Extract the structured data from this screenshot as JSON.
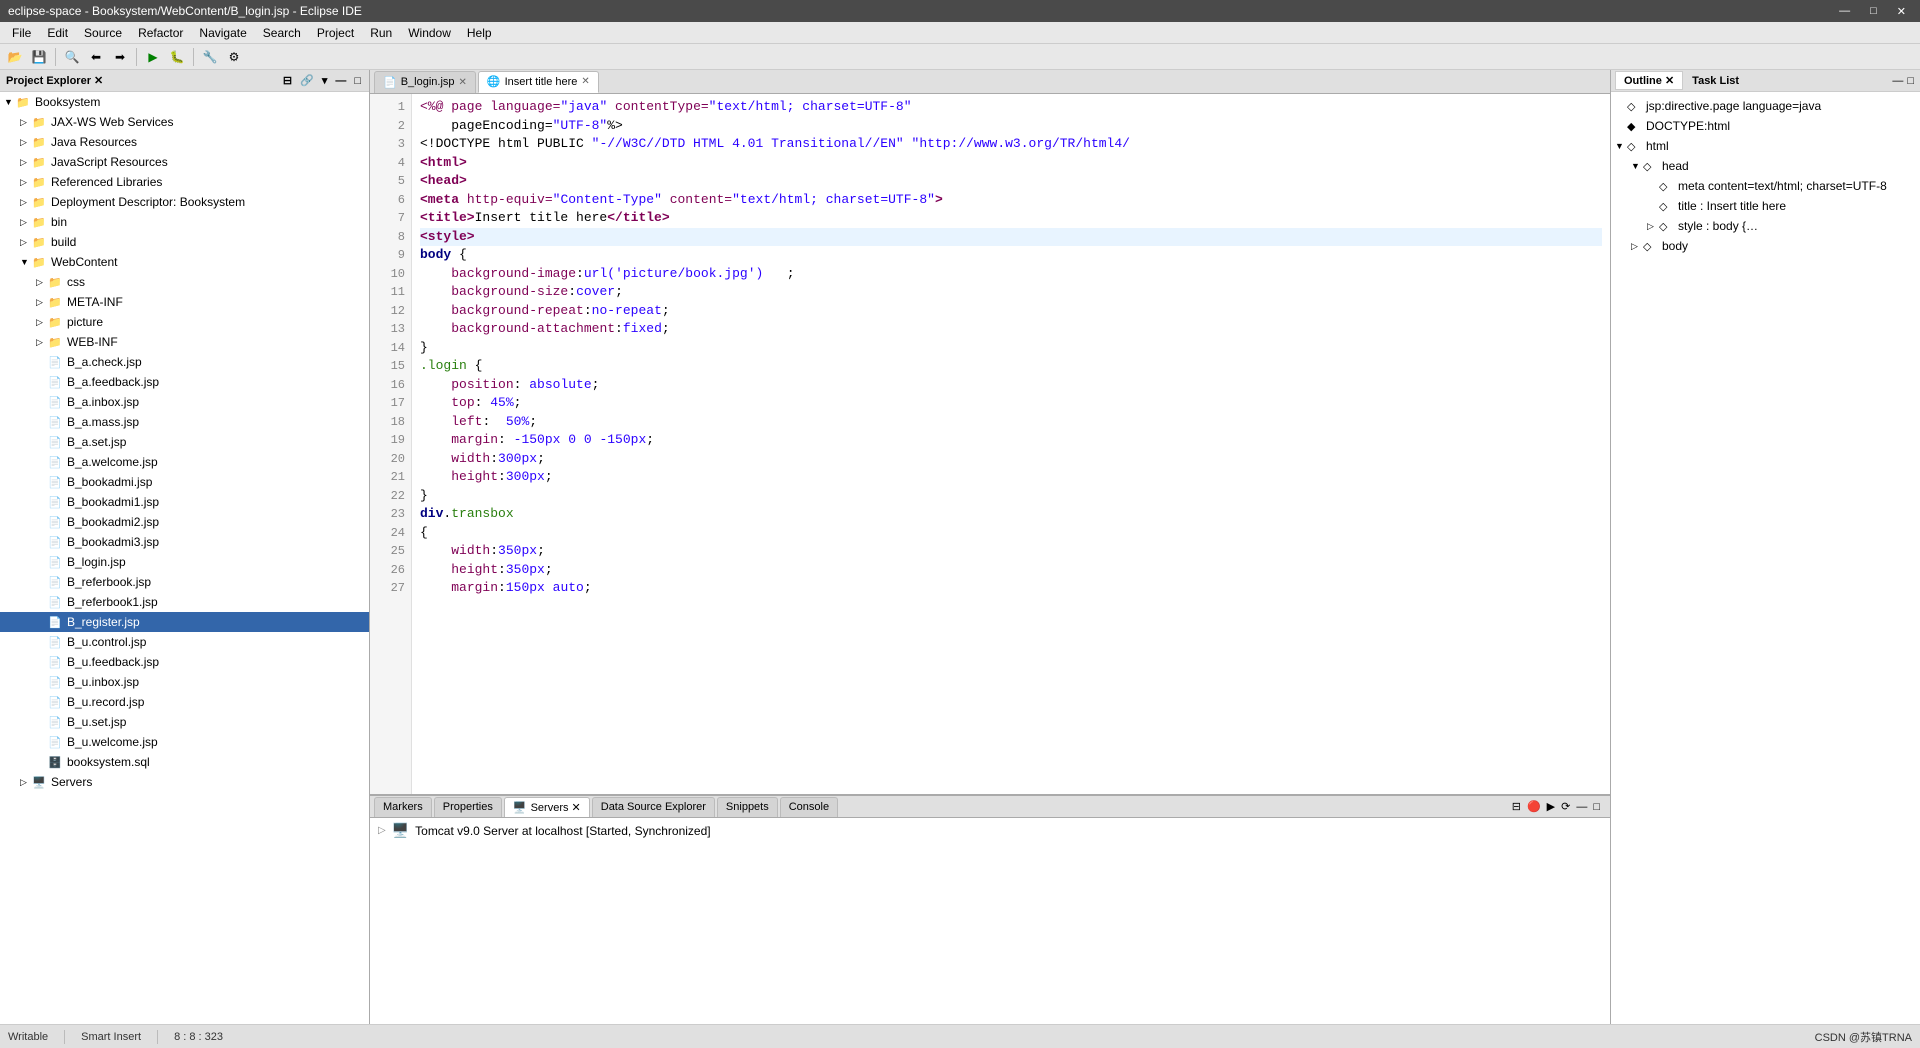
{
  "titlebar": {
    "title": "eclipse-space - Booksystem/WebContent/B_login.jsp - Eclipse IDE",
    "min_label": "—",
    "max_label": "□",
    "close_label": "✕"
  },
  "menubar": {
    "items": [
      "File",
      "Edit",
      "Source",
      "Refactor",
      "Navigate",
      "Search",
      "Project",
      "Run",
      "Window",
      "Help"
    ]
  },
  "left_panel": {
    "title": "Project Explorer ✕",
    "tree": [
      {
        "indent": 0,
        "arrow": "▼",
        "icon": "📁",
        "label": "Booksystem",
        "type": "project"
      },
      {
        "indent": 1,
        "arrow": "▷",
        "icon": "📁",
        "label": "JAX-WS Web Services",
        "type": "folder"
      },
      {
        "indent": 1,
        "arrow": "▷",
        "icon": "📁",
        "label": "Java Resources",
        "type": "folder"
      },
      {
        "indent": 1,
        "arrow": "▷",
        "icon": "📁",
        "label": "JavaScript Resources",
        "type": "folder"
      },
      {
        "indent": 1,
        "arrow": "▷",
        "icon": "📁",
        "label": "Referenced Libraries",
        "type": "folder"
      },
      {
        "indent": 1,
        "arrow": "▷",
        "icon": "📁",
        "label": "Deployment Descriptor: Booksystem",
        "type": "folder"
      },
      {
        "indent": 1,
        "arrow": "▷",
        "icon": "📁",
        "label": "bin",
        "type": "folder"
      },
      {
        "indent": 1,
        "arrow": "▷",
        "icon": "📁",
        "label": "build",
        "type": "folder"
      },
      {
        "indent": 1,
        "arrow": "▼",
        "icon": "📁",
        "label": "WebContent",
        "type": "folder"
      },
      {
        "indent": 2,
        "arrow": "▷",
        "icon": "📁",
        "label": "css",
        "type": "folder"
      },
      {
        "indent": 2,
        "arrow": "▷",
        "icon": "📁",
        "label": "META-INF",
        "type": "folder"
      },
      {
        "indent": 2,
        "arrow": "▷",
        "icon": "📁",
        "label": "picture",
        "type": "folder"
      },
      {
        "indent": 2,
        "arrow": "▷",
        "icon": "📁",
        "label": "WEB-INF",
        "type": "folder"
      },
      {
        "indent": 2,
        "arrow": "",
        "icon": "📄",
        "label": "B_a.check.jsp",
        "type": "file"
      },
      {
        "indent": 2,
        "arrow": "",
        "icon": "📄",
        "label": "B_a.feedback.jsp",
        "type": "file"
      },
      {
        "indent": 2,
        "arrow": "",
        "icon": "📄",
        "label": "B_a.inbox.jsp",
        "type": "file"
      },
      {
        "indent": 2,
        "arrow": "",
        "icon": "📄",
        "label": "B_a.mass.jsp",
        "type": "file"
      },
      {
        "indent": 2,
        "arrow": "",
        "icon": "📄",
        "label": "B_a.set.jsp",
        "type": "file"
      },
      {
        "indent": 2,
        "arrow": "",
        "icon": "📄",
        "label": "B_a.welcome.jsp",
        "type": "file"
      },
      {
        "indent": 2,
        "arrow": "",
        "icon": "📄",
        "label": "B_bookadmi.jsp",
        "type": "file"
      },
      {
        "indent": 2,
        "arrow": "",
        "icon": "📄",
        "label": "B_bookadmi1.jsp",
        "type": "file"
      },
      {
        "indent": 2,
        "arrow": "",
        "icon": "📄",
        "label": "B_bookadmi2.jsp",
        "type": "file"
      },
      {
        "indent": 2,
        "arrow": "",
        "icon": "📄",
        "label": "B_bookadmi3.jsp",
        "type": "file"
      },
      {
        "indent": 2,
        "arrow": "",
        "icon": "📄",
        "label": "B_login.jsp",
        "type": "file"
      },
      {
        "indent": 2,
        "arrow": "",
        "icon": "📄",
        "label": "B_referbook.jsp",
        "type": "file"
      },
      {
        "indent": 2,
        "arrow": "",
        "icon": "📄",
        "label": "B_referbook1.jsp",
        "type": "file"
      },
      {
        "indent": 2,
        "arrow": "",
        "icon": "📄",
        "label": "B_register.jsp",
        "type": "file",
        "selected": true
      },
      {
        "indent": 2,
        "arrow": "",
        "icon": "📄",
        "label": "B_u.control.jsp",
        "type": "file"
      },
      {
        "indent": 2,
        "arrow": "",
        "icon": "📄",
        "label": "B_u.feedback.jsp",
        "type": "file"
      },
      {
        "indent": 2,
        "arrow": "",
        "icon": "📄",
        "label": "B_u.inbox.jsp",
        "type": "file"
      },
      {
        "indent": 2,
        "arrow": "",
        "icon": "📄",
        "label": "B_u.record.jsp",
        "type": "file"
      },
      {
        "indent": 2,
        "arrow": "",
        "icon": "📄",
        "label": "B_u.set.jsp",
        "type": "file"
      },
      {
        "indent": 2,
        "arrow": "",
        "icon": "📄",
        "label": "B_u.welcome.jsp",
        "type": "file"
      },
      {
        "indent": 2,
        "arrow": "",
        "icon": "🗄️",
        "label": "booksystem.sql",
        "type": "file"
      },
      {
        "indent": 1,
        "arrow": "▷",
        "icon": "🖥️",
        "label": "Servers",
        "type": "folder"
      }
    ]
  },
  "editor": {
    "tabs": [
      {
        "label": "B_login.jsp",
        "icon": "📄",
        "active": false
      },
      {
        "label": "Insert title here",
        "icon": "🌐",
        "active": true
      }
    ],
    "active_line": 8,
    "lines": [
      {
        "num": 1,
        "code": "<%@ page language=\"java\" contentType=\"text/html; charset=UTF-8\""
      },
      {
        "num": 2,
        "code": "    pageEncoding=\"UTF-8\"%>"
      },
      {
        "num": 3,
        "code": "<!DOCTYPE html PUBLIC \"-//W3C//DTD HTML 4.01 Transitional//EN\" \"http://www.w3.org/TR/html4/"
      },
      {
        "num": 4,
        "code": "<html>"
      },
      {
        "num": 5,
        "code": "<head>"
      },
      {
        "num": 6,
        "code": "<meta http-equiv=\"Content-Type\" content=\"text/html; charset=UTF-8\">"
      },
      {
        "num": 7,
        "code": "<title>Insert title here</title>"
      },
      {
        "num": 8,
        "code": "<style>"
      },
      {
        "num": 9,
        "code": "body {"
      },
      {
        "num": 10,
        "code": "    background-image:url('picture/book.jpg')   ;"
      },
      {
        "num": 11,
        "code": "    background-size:cover;"
      },
      {
        "num": 12,
        "code": "    background-repeat:no-repeat;"
      },
      {
        "num": 13,
        "code": "    background-attachment:fixed;"
      },
      {
        "num": 14,
        "code": "}"
      },
      {
        "num": 15,
        "code": ".login {"
      },
      {
        "num": 16,
        "code": "    position: absolute;"
      },
      {
        "num": 17,
        "code": "    top: 45%;"
      },
      {
        "num": 18,
        "code": "    left: 50%;"
      },
      {
        "num": 19,
        "code": "    margin: -150px 0 0 -150px;"
      },
      {
        "num": 20,
        "code": "    width:300px;"
      },
      {
        "num": 21,
        "code": "    height:300px;"
      },
      {
        "num": 22,
        "code": "}"
      },
      {
        "num": 23,
        "code": "div.transbox"
      },
      {
        "num": 24,
        "code": "{"
      },
      {
        "num": 25,
        "code": "    width:350px;"
      },
      {
        "num": 26,
        "code": "    height:350px;"
      },
      {
        "num": 27,
        "code": "    margin:150px auto;"
      }
    ]
  },
  "bottom_panel": {
    "tabs": [
      "Markers",
      "Properties",
      "Servers",
      "Data Source Explorer",
      "Snippets",
      "Console"
    ],
    "active_tab": "Servers",
    "servers": [
      {
        "label": "Tomcat v9.0 Server at localhost  [Started, Synchronized]",
        "status": "started"
      }
    ]
  },
  "right_panel": {
    "tabs": [
      "Outline",
      "Task List"
    ],
    "active_tab": "Outline",
    "tree": [
      {
        "indent": 0,
        "arrow": "",
        "icon": "◇",
        "label": "jsp:directive.page language=java",
        "detail": ""
      },
      {
        "indent": 0,
        "arrow": "",
        "icon": "◆",
        "label": "DOCTYPE:html",
        "detail": ""
      },
      {
        "indent": 0,
        "arrow": "▼",
        "icon": "◇",
        "label": "html",
        "detail": ""
      },
      {
        "indent": 1,
        "arrow": "▼",
        "icon": "◇",
        "label": "head",
        "detail": ""
      },
      {
        "indent": 2,
        "arrow": "",
        "icon": "◇",
        "label": "meta content=text/html; charset=UTF-8",
        "detail": ""
      },
      {
        "indent": 2,
        "arrow": "",
        "icon": "◇",
        "label": "title : Insert title here",
        "detail": ""
      },
      {
        "indent": 2,
        "arrow": "▷",
        "icon": "◇",
        "label": "style : body {…",
        "detail": ""
      },
      {
        "indent": 1,
        "arrow": "▷",
        "icon": "◇",
        "label": "body",
        "detail": ""
      }
    ]
  },
  "statusbar": {
    "writable": "Writable",
    "insert_mode": "Smart Insert",
    "position": "8 : 8 : 323",
    "right_info": "CSDN @苏镇TRNA"
  }
}
